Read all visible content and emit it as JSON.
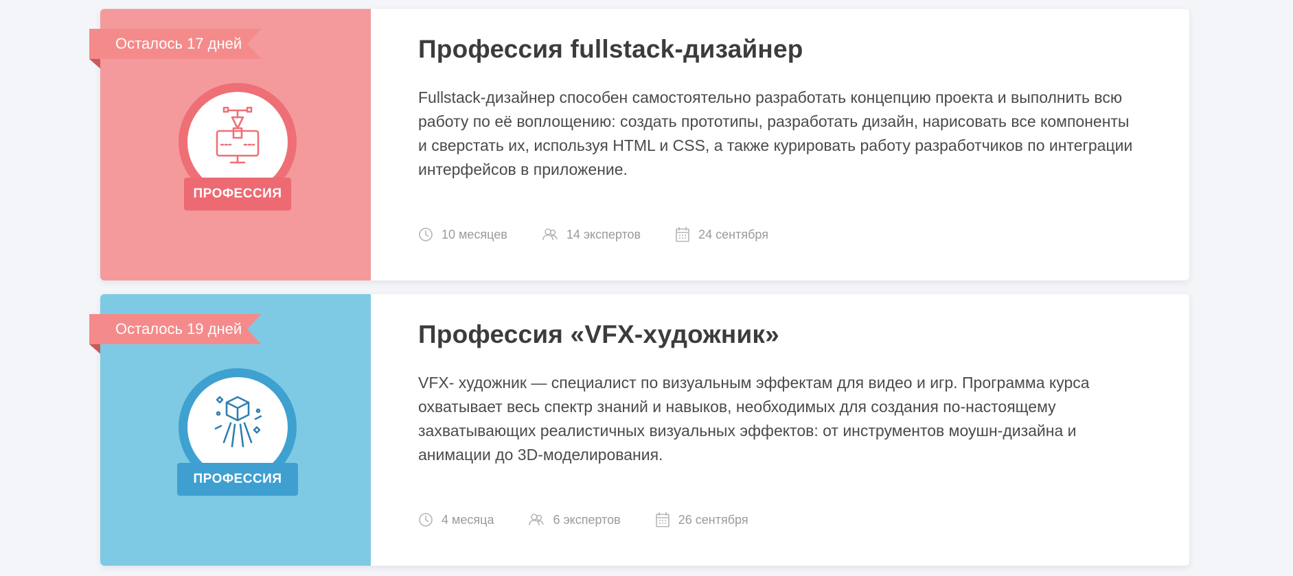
{
  "courses": [
    {
      "ribbon": "Осталось 17 дней",
      "badge_label": "ПРОФЕССИЯ",
      "badge_icon": "design-tool-icon",
      "title": "Профессия fullstack-дизайнер",
      "description": "Fullstack-дизайнер способен самостоятельно разработать концепцию проекта и выполнить всю работу по её воплощению: создать прототипы, разработать дизайн, нарисовать все компоненты и сверстать их, используя HTML и CSS, а также курировать работу разработчиков по интеграции интерфейсов в приложение.",
      "duration": "10 месяцев",
      "experts": "14 экспертов",
      "start_date": "24 сентября",
      "colors": {
        "bg": "#f4999c",
        "ring": "#ee6f76",
        "label": "#ed6a72",
        "ribbon": "#f58a8a",
        "ribbon_fold": "#c85a5a"
      }
    },
    {
      "ribbon": "Осталось 19 дней",
      "badge_label": "ПРОФЕССИЯ",
      "badge_icon": "3d-cube-icon",
      "title": "Профессия «VFX-художник»",
      "description": "VFX- художник — специалист по визуальным эффектам для видео и игр. Программа курса охватывает весь спектр знаний и навыков, необходимых для создания по-настоящему захватывающих реалистичных визуальных эффектов: от инструментов моушн-дизайна и анимации до 3D-моделирования.",
      "duration": "4 месяца",
      "experts": "6 экспертов",
      "start_date": "26 сентября",
      "colors": {
        "bg": "#7ecae4",
        "ring": "#3ea1d0",
        "label": "#3f9fd1",
        "ribbon": "#f58a8a",
        "ribbon_fold": "#c85a5a"
      }
    }
  ]
}
